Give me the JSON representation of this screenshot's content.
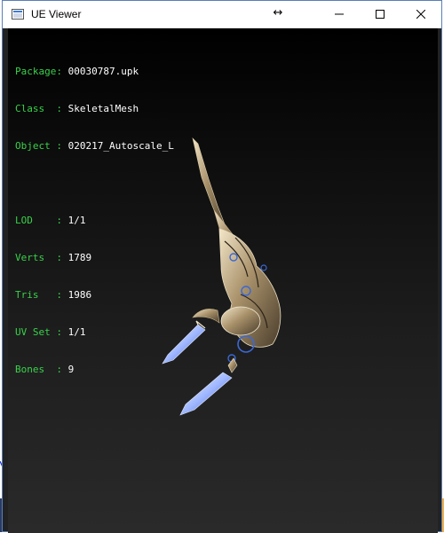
{
  "window": {
    "title": "UE Viewer"
  },
  "info": {
    "package_label": "Package:",
    "package_value": "00030787.upk",
    "class_label": "Class  :",
    "class_value": "SkeletalMesh",
    "object_label": "Object :",
    "object_value": "020217_Autoscale_L",
    "lod_label": "LOD    :",
    "lod_value": "1/1",
    "verts_label": "Verts  :",
    "verts_value": "1789",
    "tris_label": "Tris   :",
    "tris_value": "1986",
    "uvset_label": "UV Set :",
    "uvset_value": "1/1",
    "bones_label": "Bones  :",
    "bones_value": "9"
  },
  "icons": {
    "app": "ue-viewer-app-icon",
    "resize": "resize-arrows-icon",
    "minimize": "minimize-icon",
    "maximize": "maximize-icon",
    "close": "close-icon"
  }
}
